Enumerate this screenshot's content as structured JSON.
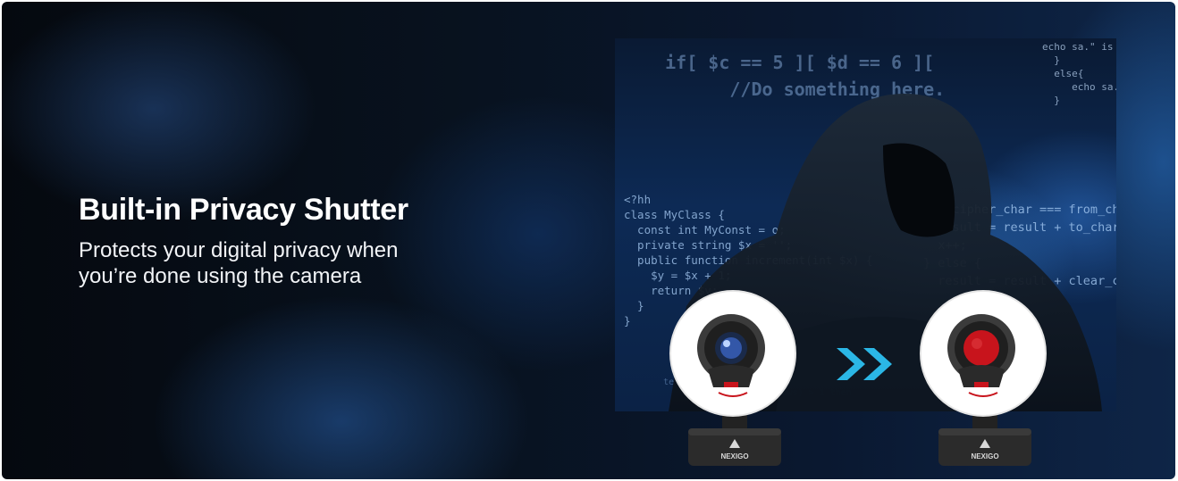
{
  "headline": "Built-in Privacy Shutter",
  "subline": "Protects your digital privacy when you’re done using the camera",
  "icons": {
    "arrow": "double-chevron-right-icon",
    "brand": "nexigo-logo-icon"
  },
  "colors": {
    "arrow": "#2bb7e6",
    "shutter": "#c8141c",
    "ring_light": "#ffffff",
    "base": "#2a2a2a"
  },
  "brand": "NEXIGO"
}
